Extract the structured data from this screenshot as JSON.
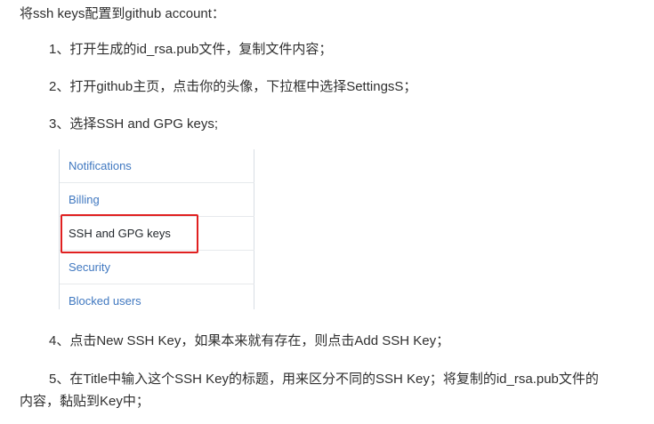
{
  "intro": "将ssh keys配置到github account：",
  "steps": {
    "step1": "1、打开生成的id_rsa.pub文件，复制文件内容；",
    "step2": "2、打开github主页，点击你的头像，下拉框中选择SettingsS；",
    "step3": "3、选择SSH and GPG keys;",
    "step4": "4、点击New SSH Key，如果本来就有存在，则点击Add SSH Key；",
    "step5_line1": "5、在Title中输入这个SSH Key的标题，用来区分不同的SSH Key；将复制的id_rsa.pub文件的",
    "step5_line2": "内容，黏贴到Key中；"
  },
  "settings_menu": {
    "items": [
      {
        "label": "Notifications"
      },
      {
        "label": "Billing"
      },
      {
        "label": "SSH and GPG keys",
        "selected": true
      },
      {
        "label": "Security"
      },
      {
        "label": "Blocked users"
      }
    ]
  },
  "colors": {
    "link": "#4078c0",
    "selected_text": "#24292e",
    "highlight_border": "#e02020",
    "body_text": "#2f2f2f"
  }
}
